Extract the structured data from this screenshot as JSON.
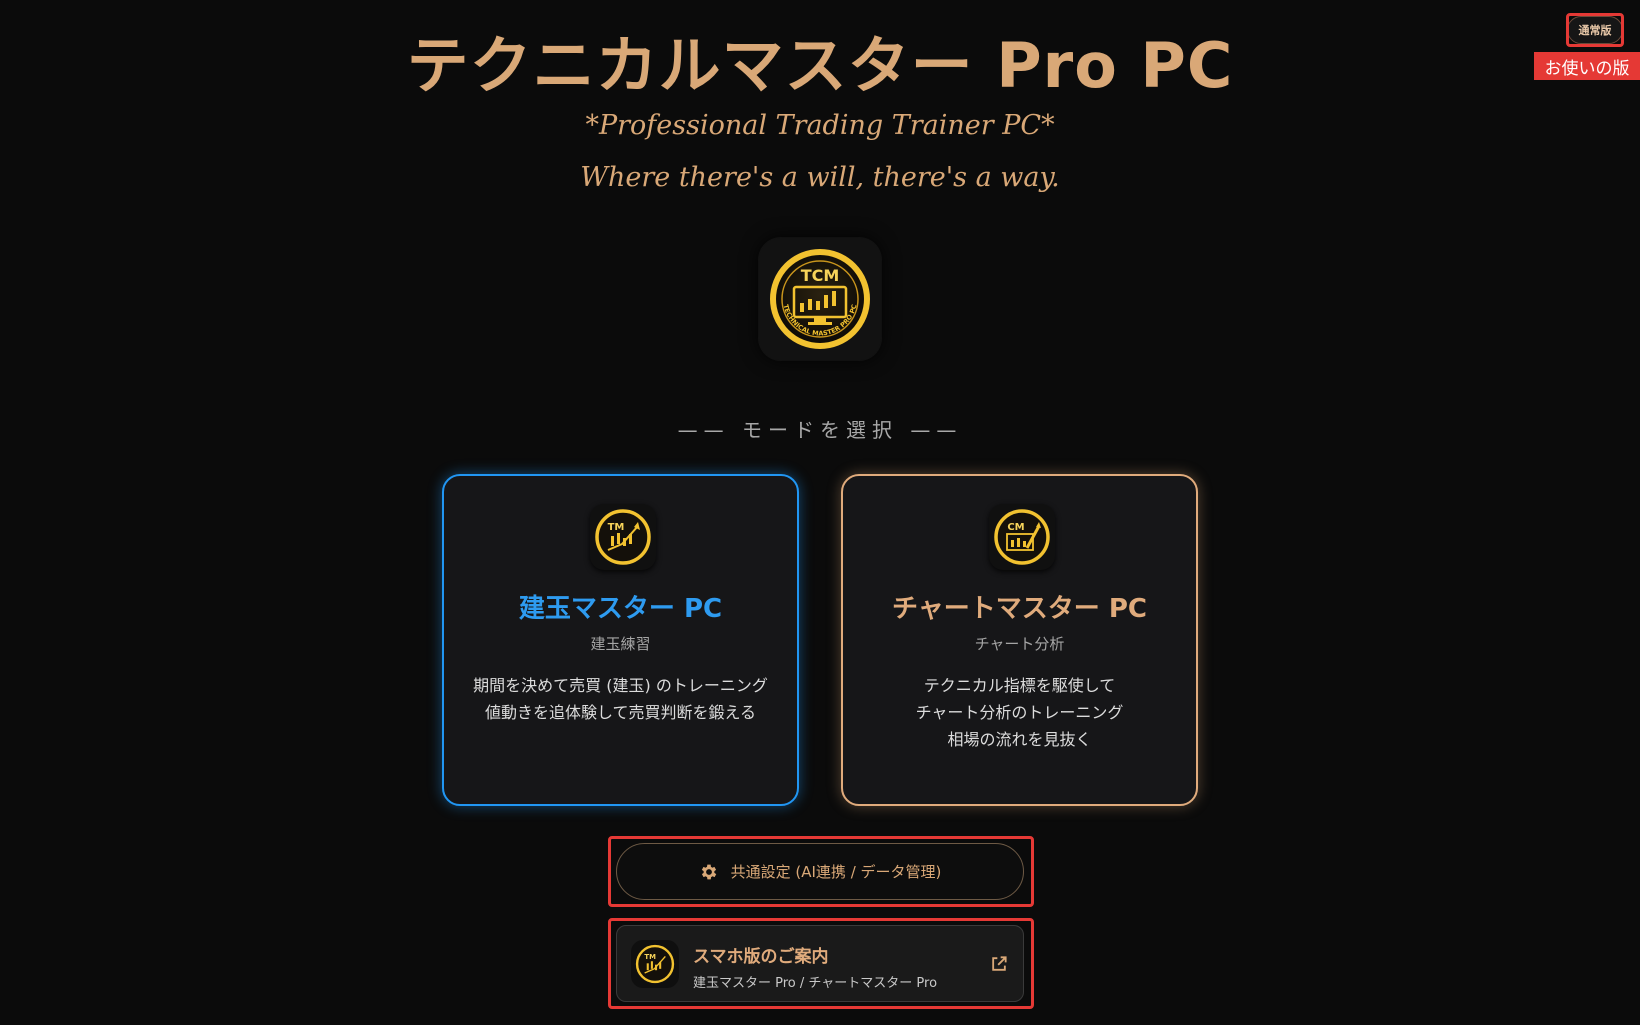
{
  "header": {
    "title": "テクニカルマスター Pro PC",
    "subtitle": "*Professional Trading Trainer PC*",
    "tagline": "Where there's a will, there's a way."
  },
  "logo": {
    "icon": "tcm-logo-icon",
    "text": "TCM",
    "ring_text": "TECHNICAL MASTER PRO PC"
  },
  "mode_select": {
    "header": "—— モードを選択 ——",
    "cards": [
      {
        "title": "建玉マスター PC",
        "subtitle": "建玉練習",
        "desc_line1": "期間を決めて売買 (建玉) のトレーニング",
        "desc_line2": "値動きを追体験して売買判断を鍛える",
        "icon_text": "TM",
        "accent": "#2196f3"
      },
      {
        "title": "チャートマスター PC",
        "subtitle": "チャート分析",
        "desc_line1": "テクニカル指標を駆使して",
        "desc_line2": "チャート分析のトレーニング",
        "desc_line3": "相場の流れを見抜く",
        "icon_text": "CM",
        "accent": "#e0ab7c"
      }
    ]
  },
  "settings_button": {
    "label": "共通設定 (AI連携 / データ管理)",
    "icon": "gear-icon"
  },
  "mobile_button": {
    "title": "スマホ版のご案内",
    "subtitle": "建玉マスター Pro / チャートマスター Pro",
    "icon_text": "TM",
    "ext_icon": "external-link-icon"
  },
  "top_right": {
    "badge": "通常版",
    "label": "お使いの版"
  },
  "colors": {
    "gold": "#d9a877",
    "blue": "#2196f3",
    "highlight_red": "#e53935",
    "background": "#0b0b0b"
  }
}
